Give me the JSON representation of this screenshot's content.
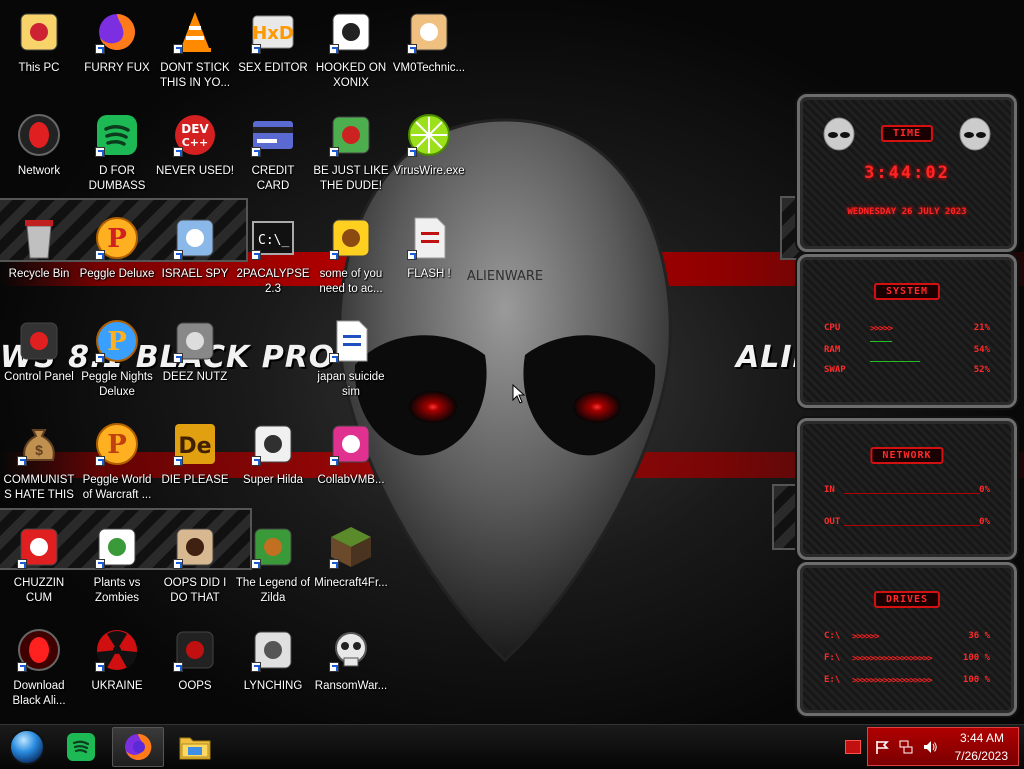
{
  "wallpaper": {
    "left_text": "WS 8.1 BLACK PRO",
    "right_text": "ALIENWARE",
    "alien_logo_text": "ALIENWARE"
  },
  "desktop_icons": [
    {
      "label": "This PC",
      "icon": "cartoon-face-icon"
    },
    {
      "label": "FURRY FUX",
      "icon": "firefox-icon"
    },
    {
      "label": "DONT STICK THIS IN YO...",
      "icon": "vlc-cone-icon"
    },
    {
      "label": "SEX EDITOR",
      "icon": "hex-editor-icon"
    },
    {
      "label": "HOOKED ON XONIX",
      "icon": "xonix-game-icon"
    },
    {
      "label": "VM0Technic...",
      "icon": "technician-person-icon"
    },
    {
      "label": "Network",
      "icon": "alien-network-icon"
    },
    {
      "label": "D FOR DUMBASS",
      "icon": "spotify-icon"
    },
    {
      "label": "NEVER USED!",
      "icon": "devcpp-icon"
    },
    {
      "label": "CREDIT CARD CHECKER",
      "icon": "credit-card-icon"
    },
    {
      "label": "BE JUST LIKE THE DUDE!",
      "icon": "elf-character-icon"
    },
    {
      "label": "VirusWire.exe",
      "icon": "lime-icon"
    },
    {
      "label": "Recycle Bin",
      "icon": "recycle-bin-icon"
    },
    {
      "label": "Peggle Deluxe",
      "icon": "peggle-icon"
    },
    {
      "label": "ISRAEL SPY",
      "icon": "network-spy-icon"
    },
    {
      "label": "2PACALYPSE 2.3",
      "icon": "terminal-icon"
    },
    {
      "label": "some of you need to ac...",
      "icon": "dog-character-icon"
    },
    {
      "label": "FLASH !",
      "icon": "flash-file-icon"
    },
    {
      "label": "Control Panel",
      "icon": "control-panel-icon"
    },
    {
      "label": "Peggle Nights Deluxe",
      "icon": "peggle-nights-icon"
    },
    {
      "label": "DEEZ NUTZ",
      "icon": "stacked-windows-icon"
    },
    {
      "label": "japan suicide sim",
      "icon": "document-icon"
    },
    {
      "label": "COMMUNISTS HATE THIS G...",
      "icon": "money-bag-icon"
    },
    {
      "label": "Peggle World of Warcraft ...",
      "icon": "peggle-wow-icon"
    },
    {
      "label": "DIE PLEASE",
      "icon": "de-app-icon"
    },
    {
      "label": "Super Hilda",
      "icon": "pixel-character-icon"
    },
    {
      "label": "CollabVMB...",
      "icon": "collabvm-icon"
    },
    {
      "label": "CHUZZIN CUM",
      "icon": "chuzzle-icon"
    },
    {
      "label": "Plants vs Zombies",
      "icon": "flower-icon"
    },
    {
      "label": "OOPS DID I DO THAT",
      "icon": "portrait-icon"
    },
    {
      "label": "The Legend of Zilda",
      "icon": "pixel-hero-icon"
    },
    {
      "label": "Minecraft4Fr...",
      "icon": "grass-block-icon"
    },
    {
      "label": "Download Black Ali...",
      "icon": "alien-orb-icon"
    },
    {
      "label": "UKRAINE",
      "icon": "radiation-icon"
    },
    {
      "label": "OOPS",
      "icon": "red-monitor-icon"
    },
    {
      "label": "LYNCHING",
      "icon": "rope-icon"
    },
    {
      "label": "RansomWar...",
      "icon": "skull-icon"
    }
  ],
  "widgets": {
    "time": {
      "title": "TIME",
      "clock": "3:44:02",
      "date": "WEDNESDAY 26 JULY 2023"
    },
    "system": {
      "title": "SYSTEM",
      "rows": [
        {
          "label": "CPU",
          "bar": ">>>>>",
          "value": "21%"
        },
        {
          "label": "RAM",
          "bar": "",
          "value": "54%"
        },
        {
          "label": "SWAP",
          "bar": "",
          "value": "52%"
        }
      ]
    },
    "network": {
      "title": "NETWORK",
      "rows": [
        {
          "label": "IN",
          "value": "0%"
        },
        {
          "label": "OUT",
          "value": "0%"
        }
      ]
    },
    "drives": {
      "title": "DRIVES",
      "rows": [
        {
          "label": "C:\\",
          "bar": ">>>>>>",
          "value": "36 %"
        },
        {
          "label": "F:\\",
          "bar": ">>>>>>>>>>>>>>>>>>",
          "value": "100 %"
        },
        {
          "label": "E:\\",
          "bar": ">>>>>>>>>>>>>>>>>>",
          "value": "100 %"
        }
      ]
    }
  },
  "taskbar": {
    "start_icon": "start-orb-icon",
    "pinned": [
      {
        "name": "spotify-icon"
      },
      {
        "name": "firefox-icon",
        "active": true
      },
      {
        "name": "file-explorer-icon"
      }
    ],
    "tray": {
      "icons": [
        "action-center-flag-icon",
        "network-icon",
        "volume-icon"
      ],
      "time": "3:44 AM",
      "date": "7/26/2023"
    }
  },
  "colors": {
    "accent_red": "#d41111",
    "tray_red": "#b00000",
    "led_red": "#ff2525"
  }
}
